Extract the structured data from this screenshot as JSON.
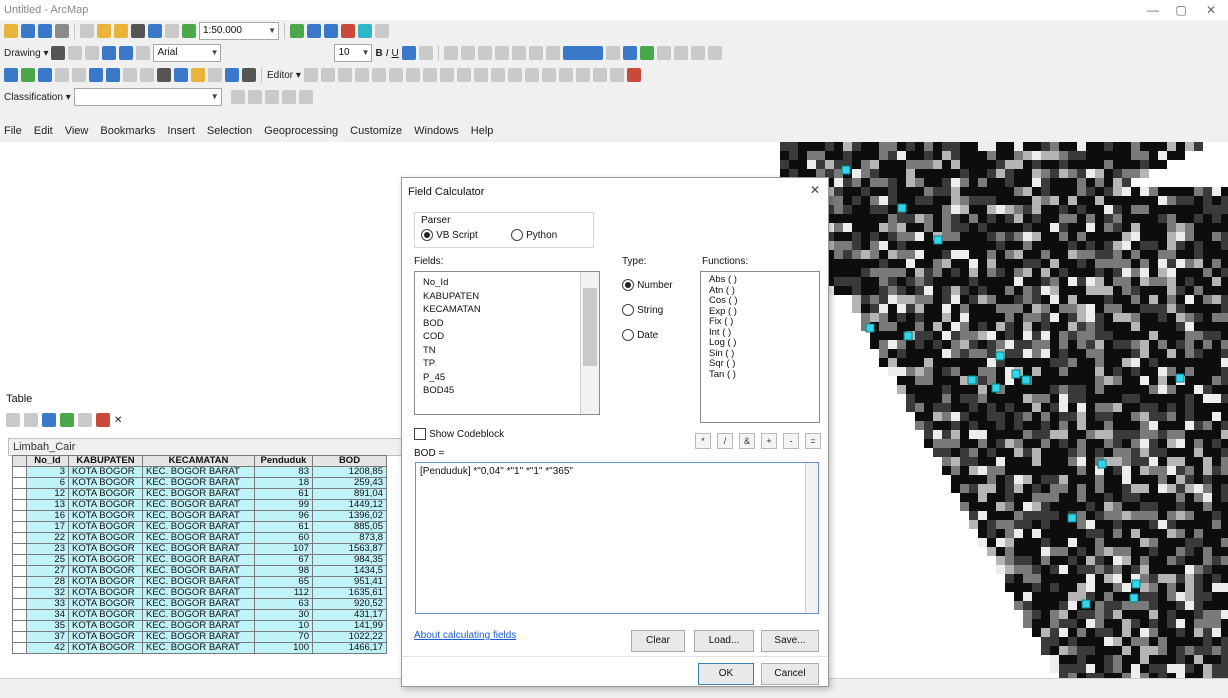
{
  "window": {
    "title": "Untitled - ArcMap",
    "minimize": "—",
    "maximize": "▢",
    "close": "✕"
  },
  "toolbar": {
    "scale": "1:50.000",
    "drawing_label": "Drawing ▾",
    "font_name": "Arial",
    "font_size": "10",
    "editor_label": "Editor ▾",
    "classification_label": "Classification ▾"
  },
  "menu": [
    "File",
    "Edit",
    "View",
    "Bookmarks",
    "Insert",
    "Selection",
    "Geoprocessing",
    "Customize",
    "Windows",
    "Help"
  ],
  "table_window": {
    "label": "Table",
    "layer_title": "Limbah_Cair",
    "columns": [
      "No_Id",
      "KABUPATEN",
      "KECAMATAN",
      "Penduduk",
      "BOD"
    ],
    "rows": [
      [
        "3",
        "KOTA BOGOR",
        "KEC. BOGOR BARAT",
        "83",
        "1208,85"
      ],
      [
        "6",
        "KOTA BOGOR",
        "KEC. BOGOR BARAT",
        "18",
        "259,43"
      ],
      [
        "12",
        "KOTA BOGOR",
        "KEC. BOGOR BARAT",
        "61",
        "891,04"
      ],
      [
        "13",
        "KOTA BOGOR",
        "KEC. BOGOR BARAT",
        "99",
        "1449,12"
      ],
      [
        "16",
        "KOTA BOGOR",
        "KEC. BOGOR BARAT",
        "96",
        "1396,02"
      ],
      [
        "17",
        "KOTA BOGOR",
        "KEC. BOGOR BARAT",
        "61",
        "885,05"
      ],
      [
        "22",
        "KOTA BOGOR",
        "KEC. BOGOR BARAT",
        "60",
        "873,8"
      ],
      [
        "23",
        "KOTA BOGOR",
        "KEC. BOGOR BARAT",
        "107",
        "1563,87"
      ],
      [
        "25",
        "KOTA BOGOR",
        "KEC. BOGOR BARAT",
        "67",
        "984,35"
      ],
      [
        "27",
        "KOTA BOGOR",
        "KEC. BOGOR BARAT",
        "98",
        "1434,5"
      ],
      [
        "28",
        "KOTA BOGOR",
        "KEC. BOGOR BARAT",
        "65",
        "951,41"
      ],
      [
        "32",
        "KOTA BOGOR",
        "KEC. BOGOR BARAT",
        "112",
        "1635,61"
      ],
      [
        "33",
        "KOTA BOGOR",
        "KEC. BOGOR BARAT",
        "63",
        "920,52"
      ],
      [
        "34",
        "KOTA BOGOR",
        "KEC. BOGOR BARAT",
        "30",
        "431,17"
      ],
      [
        "35",
        "KOTA BOGOR",
        "KEC. BOGOR BARAT",
        "10",
        "141,99"
      ],
      [
        "37",
        "KOTA BOGOR",
        "KEC. BOGOR BARAT",
        "70",
        "1022,22"
      ],
      [
        "42",
        "KOTA BOGOR",
        "KEC. BOGOR BARAT",
        "100",
        "1466,17"
      ]
    ]
  },
  "dialog": {
    "title": "Field Calculator",
    "close_glyph": "✕",
    "parser_label": "Parser",
    "parser_vb": "VB Script",
    "parser_python": "Python",
    "fields_label": "Fields:",
    "fields": [
      "No_Id",
      "KABUPATEN",
      "KECAMATAN",
      "BOD",
      "COD",
      "TN",
      "TP",
      "P_45",
      "BOD45"
    ],
    "type_label": "Type:",
    "types": [
      "Number",
      "String",
      "Date"
    ],
    "functions_label": "Functions:",
    "functions": [
      "Abs ( )",
      "Atn ( )",
      "Cos ( )",
      "Exp ( )",
      "Fix ( )",
      "Int ( )",
      "Log ( )",
      "Sin ( )",
      "Sqr ( )",
      "Tan ( )"
    ],
    "show_codeblock": "Show Codeblock",
    "operators": [
      "*",
      "/",
      "&",
      "+",
      "-",
      "="
    ],
    "target_label": "BOD =",
    "expression": "[Penduduk] *\"0,04\" *\"1\" *\"1\" *\"365\"",
    "about_link": "About calculating fields",
    "clear": "Clear",
    "load": "Load...",
    "save": "Save...",
    "ok": "OK",
    "cancel": "Cancel"
  },
  "colors": {
    "table_cell": "#bff3f8",
    "map_point": "#33d6e6",
    "link": "#1a5ecf"
  }
}
